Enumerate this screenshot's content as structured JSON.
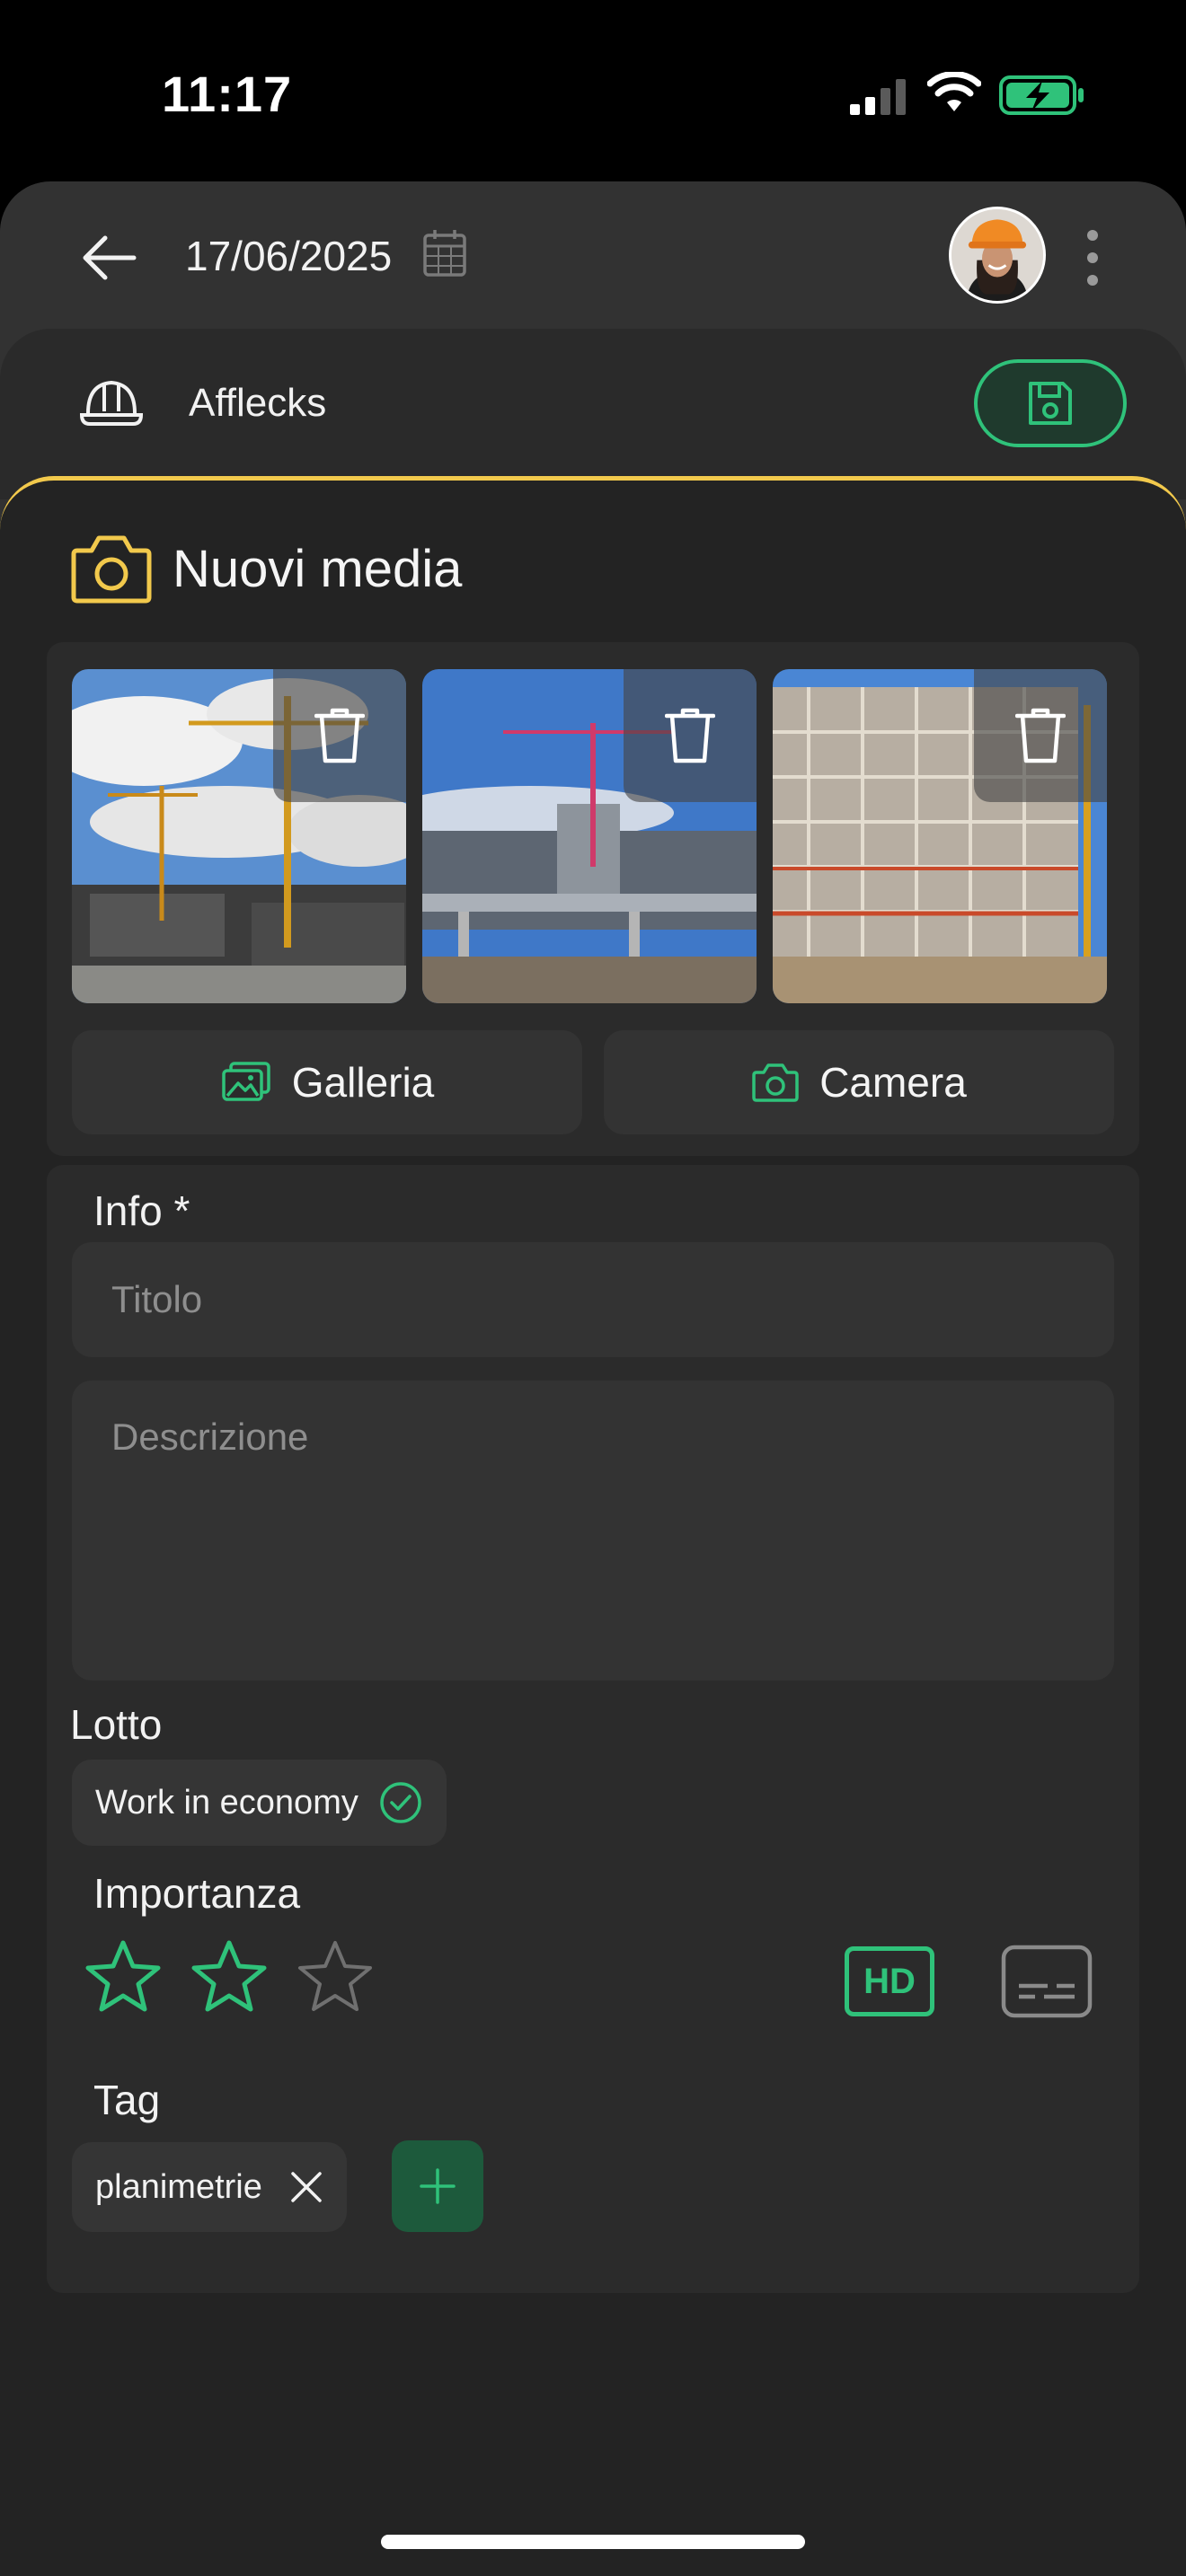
{
  "status_bar": {
    "time": "11:17"
  },
  "header": {
    "date": "17/06/2025",
    "site_name": "Afflecks"
  },
  "media": {
    "title": "Nuovi media",
    "photos": [
      {
        "alt": "Cantiere con gru e cielo nuvoloso"
      },
      {
        "alt": "Cantiere con struttura in cemento"
      },
      {
        "alt": "Edificio con ponteggi"
      }
    ],
    "gallery_label": "Galleria",
    "camera_label": "Camera"
  },
  "form": {
    "info_label": "Info *",
    "title_placeholder": "Titolo",
    "description_placeholder": "Descrizione",
    "lotto_label": "Lotto",
    "lotto_value": "Work in economy",
    "importance_label": "Importanza",
    "rating": 2,
    "rating_max": 3,
    "hd_label": "HD",
    "tag_label": "Tag",
    "tags": [
      "planimetrie"
    ]
  },
  "colors": {
    "accent_green": "#2fc27a",
    "accent_yellow": "#f2c94c",
    "background": "#232323"
  }
}
